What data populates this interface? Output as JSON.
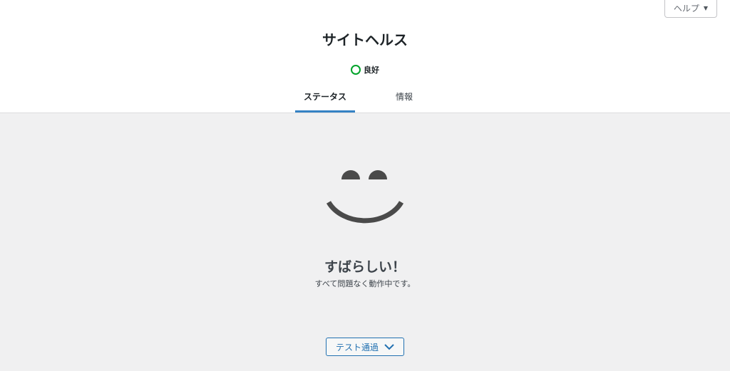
{
  "header": {
    "help_label": "ヘルプ",
    "help_caret": "▼",
    "title": "サイトヘルス",
    "status_label": "良好",
    "status_color": "#00a32a"
  },
  "tabs": [
    {
      "label": "ステータス",
      "active": true
    },
    {
      "label": "情報",
      "active": false
    }
  ],
  "result": {
    "title": "すばらしい！",
    "subtitle": "すべて問題なく動作中です。",
    "passed_button_label": "テスト通過"
  },
  "colors": {
    "accent": "#2271b1",
    "tab_underline": "#3582c4",
    "face": "#4a4a4a",
    "background": "#f0f0f1"
  }
}
